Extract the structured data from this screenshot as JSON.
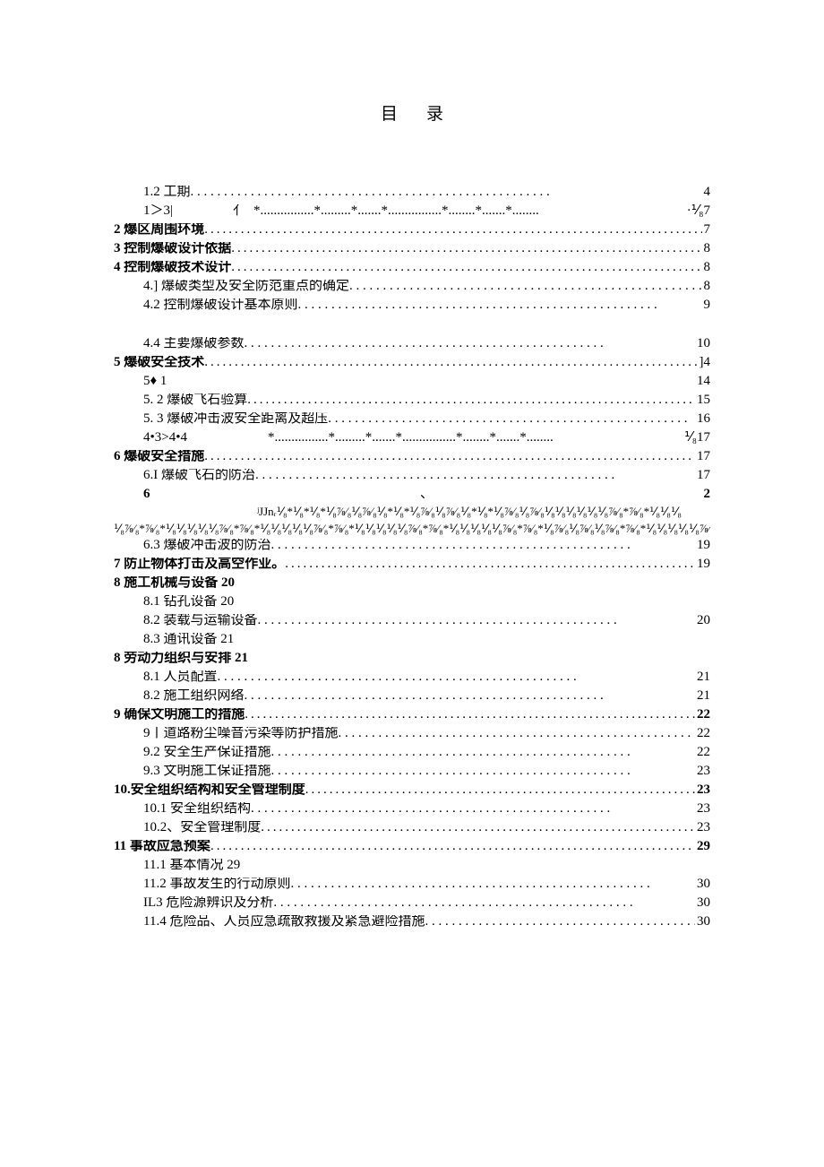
{
  "title": "目录",
  "lines": {
    "l1_2": {
      "label": "1.2 工期",
      "page": "4"
    },
    "l1_3": {
      "label": "1＞3|",
      "mid": "亻",
      "page": "·⅟₈7"
    },
    "l2": {
      "label": "2 爆区周围环境",
      "page": "7"
    },
    "l3": {
      "label": "3 控制爆破设计依据",
      "page": "8"
    },
    "l4": {
      "label": "4 控制爆破技术设计",
      "page": "8"
    },
    "l4_1": {
      "label": "4.] 爆破类型及安全防范重点的确定",
      "page": "8"
    },
    "l4_2": {
      "label": "4.2 控制爆破设计基本原则",
      "page": "9"
    },
    "l4_4": {
      "label": "4.4 主要爆破参数",
      "page": "10"
    },
    "l5": {
      "label": "5 爆破安全技术",
      "page": "]4"
    },
    "l5_1": {
      "label": "5♦   1",
      "page": "14"
    },
    "l5_2": {
      "label": "5.   2 爆破飞石验算",
      "page": "15"
    },
    "l5_3": {
      "label": "5.   3 爆破冲击波安全距离及超压",
      "page": "16"
    },
    "l434": {
      "label": "4•3>4•4",
      "page": "⅟₈17"
    },
    "l6": {
      "label": "6 爆破安全措施",
      "page": "17"
    },
    "l6_1": {
      "label": "6.I 爆破飞石的防治",
      "page": "17"
    },
    "l6_x": {
      "left": "6",
      "mid": "、",
      "right": "2"
    },
    "g1": "ʲJJnᵣ⅟₈*⅟₈*⅟₈*⅟₈⅞⁄₈⅟₈⅞⁄₈⅟₈*⅟₈*⅟₈⅞⁄₈⅟₈⅞⁄₈⅟₈*⅟₈*⅟₈⅞⁄₈⅟₈⅞⁄₈⅟₈⅟₈⅟₈⅟₈⅟₈⅟₈⅞⁄₈*⅞⁄₈*⅟₈⅟₈⅟₈",
    "g2": "⅟₈⅞⁄₈*⅞⁄₈*⅟₈⅟₈⅟₈⅟₈⅟₈⅞⁄₈*⅞⁄₈*⅟₈⅟₈⅟₈⅟₈⅟₈⅞⁄₈*⅞⁄₈*⅟₈⅟₈⅟₈⅟₈⅟₈⅞⁄₈*⅞⁄₈*⅟₈⅟₈⅟₈⅟₈⅟₈⅞⁄₈*⅞⁄₈*⅟₈⅞⁄₈⅟₈⅞⁄₈⅟₈⅞⁄₈*⅞⁄₈*⅟₈⅟₈⅟₈⅟₈⅟₈⅞⁄₈*+t18",
    "l6_3": {
      "label": "6.3 爆破冲击波的防治",
      "page": "19"
    },
    "l7": {
      "label": "7 防止物体打击及高空作业。",
      "page": "19"
    },
    "l8a": {
      "label": "8 施工机械与设备 20"
    },
    "l8_1": {
      "label": "8.1 钻孔设备 20"
    },
    "l8_2": {
      "label": "8.2 装载与运输设备",
      "page": "20"
    },
    "l8_3": {
      "label": "8.3 通讯设备 21"
    },
    "l8b": {
      "label": "8 劳动力组织与安排 21"
    },
    "l8_1b": {
      "label": "8.1 人员配置",
      "page": "21"
    },
    "l8_2b": {
      "label": "8.2 施工组织网络",
      "page": "21"
    },
    "l9": {
      "label": "9 确保文明施工的措施",
      "page": "22"
    },
    "l9_1": {
      "label": "9丨道路粉尘噪音污染等防护措施",
      "page": "22"
    },
    "l9_2": {
      "label": "9.2 安全生产保证措施",
      "page": "22"
    },
    "l9_3": {
      "label": "9.3 文明施工保证措施",
      "page": "23"
    },
    "l10": {
      "label": "10.安全组织结构和安全管理制度",
      "page": "23"
    },
    "l10_1": {
      "label": "10.1 安全组织结构",
      "page": "23"
    },
    "l10_2": {
      "label": "10.2、安全管理制度",
      "page": "23"
    },
    "l11": {
      "label": "11 事故应急预案",
      "page": "29"
    },
    "l11_1": {
      "label": "11.1 基本情况 29"
    },
    "l11_2": {
      "label": "11.2 事故发生的行动原则",
      "page": "30"
    },
    "l11_3": {
      "label": "IL3 危险源辨识及分析",
      "page": "30"
    },
    "l11_4": {
      "label": "11.4 危险品、人员应急疏散救援及紧急避险措施",
      "page": "30"
    }
  }
}
